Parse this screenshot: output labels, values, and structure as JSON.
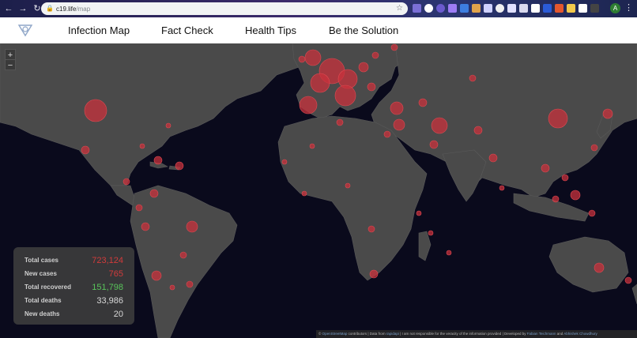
{
  "browser": {
    "url_host": "c19.life",
    "url_path": "/map",
    "back_icon": "arrow-left-icon",
    "forward_icon": "arrow-right-icon",
    "reload_icon": "reload-icon",
    "avatar_letter": "A"
  },
  "nav": {
    "links": [
      "Infection Map",
      "Fact Check",
      "Health Tips",
      "Be the Solution"
    ]
  },
  "map": {
    "zoom_in": "+",
    "zoom_out": "−",
    "bubble_color": "#c8323c",
    "land_color": "#4a4a4a",
    "sea_color": "#0a0a1c"
  },
  "stats": {
    "rows": [
      {
        "label": "Total cases",
        "value": "723,124",
        "color": "#d23b3b"
      },
      {
        "label": "New cases",
        "value": "765",
        "color": "#d23b3b"
      },
      {
        "label": "Total recovered",
        "value": "151,798",
        "color": "#58c35a"
      },
      {
        "label": "Total deaths",
        "value": "33,986",
        "color": "#d8d8d8"
      },
      {
        "label": "New deaths",
        "value": "20",
        "color": "#d8d8d8"
      }
    ]
  },
  "attribution": {
    "prefix": "©",
    "osm": "OpenStreetMap",
    "contributors": " contributors | Data from ",
    "source": "rapidapi",
    "disclaimer": " | I am not responsible for the veracity of the information provided | Developed by ",
    "dev1": "Fabian Teichmann",
    "and": " and ",
    "dev2": "Abhishek Chowdhury"
  }
}
